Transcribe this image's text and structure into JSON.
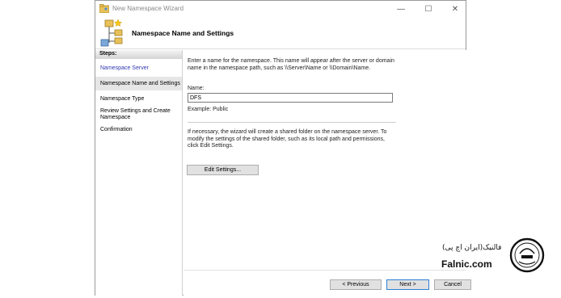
{
  "window": {
    "title": "New Namespace Wizard",
    "controls": {
      "minimize": "—",
      "maximize": "☐",
      "close": "✕"
    }
  },
  "header": {
    "title": "Namespace Name and Settings"
  },
  "sidebar": {
    "heading": "Steps:",
    "items": [
      {
        "label": "Namespace Server"
      },
      {
        "label": "Namespace Name and Settings"
      },
      {
        "label": "Namespace Type"
      },
      {
        "label": "Review Settings and Create Namespace"
      },
      {
        "label": "Confirmation"
      }
    ],
    "active_index": 0,
    "selected_index": 1
  },
  "content": {
    "intro": "Enter a name for the namespace. This name will appear after the server or domain name in the namespace path, such as \\\\Server\\Name or \\\\Domain\\Name.",
    "name_label": "Name:",
    "name_value": "DFS",
    "example": "Example: Public",
    "shared_folder_note": "If necessary, the wizard will create a shared folder on the namespace server. To modify the settings of the shared folder, such as its local path and permissions, click Edit Settings.",
    "edit_settings_label": "Edit Settings..."
  },
  "footer": {
    "previous_label": "< Previous",
    "next_label": "Next >",
    "cancel_label": "Cancel"
  },
  "watermark": {
    "brand": "Falnic.com",
    "brand_fa": "فالنیک(ایران اچ پی)",
    "colors": {
      "brand": "#111111"
    }
  },
  "colors": {
    "accent": "#2f38b0",
    "focus_border": "#2f7fd6"
  }
}
